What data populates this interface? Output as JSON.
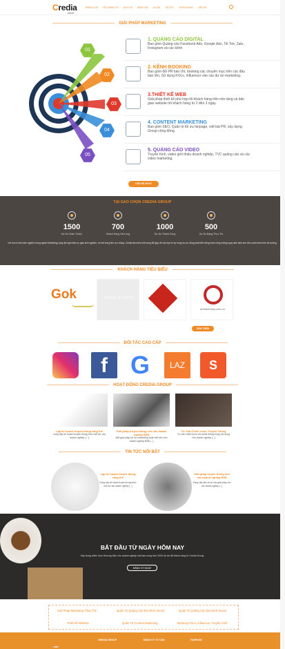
{
  "nav": {
    "logo_c": "C",
    "logo_rest": "redia",
    "logo_sub": "GROUP",
    "items": [
      "TRANG CHỦ",
      "VỀ CHÚNG TÔI",
      "DỊCH VỤ",
      "BẢNG GIÁ",
      "DỰ ÁN",
      "TIN TỨC",
      "TUYỂN DỤNG",
      "LIÊN HỆ"
    ]
  },
  "marketing": {
    "title": "GIẢI PHÁP MARKETING",
    "numbers": [
      "01",
      "02",
      "03",
      "04",
      "05"
    ],
    "items": [
      {
        "title": "1. QUẢNG CÁO DIGITAL",
        "text": "Bao gồm Quảng cáo Facebook Ads, Google Ads, Tik Tok, Zalo, Instagram và các kênh",
        "color": "#8cc63f"
      },
      {
        "title": "2. KÊNH BOOKING",
        "text": "Bao gồm đối PR báo chí, booking các chuyên mục trên các đầu báo lớn, Sử dụng KOLs, Influencer vào các dự án marketing.",
        "color": "#f08a24"
      },
      {
        "title": "3.THIẾT KẾ WEB",
        "text": "Giải pháp thiết kế phù hợp tối khách hàng trên nền tảng và bản giao website tới khách hàng từ 2 đến 3 ngày.",
        "color": "#e0392b"
      },
      {
        "title": "4. CONTENT MARKETING",
        "text": "Bao gồm SEO, Quản trị tối ưu fanpage, viết bài PR, xây dựng Group cộng đồng.",
        "color": "#3a8fd8"
      },
      {
        "title": "5. QUẢNG CÁO VIDEO",
        "text": "Truyền hình, video giới thiệu doanh nghiệp, TVC quảng cáo và các video marketing.",
        "color": "#7b4fc4"
      }
    ],
    "button": "LIÊN HỆ NGAY"
  },
  "why": {
    "title": "TẠI SAO CHỌN CREDIA GROUP",
    "stats": [
      {
        "value": "1500",
        "label": "Dự Án Hoàn Thành"
      },
      {
        "value": "700",
        "label": "Khách Hàng Hài Lòng"
      },
      {
        "value": "1000",
        "label": "Dự Án Thành Công"
      },
      {
        "value": "500",
        "label": "Dự Án Đang Thực Thi"
      }
    ],
    "desc": "Với hơn 8 năm kinh nghiệm trong ngành Marketing cùng đội ngũ nhân sự giàu kinh nghiệm, hồ hởi trong lĩnh vực thông. Credia tận hiếm mỗi dựng để giúp đỡ các bạn từ 4p trong dự án, đồng phát triển đồng hành cũng những nguy dịch lành anh đơn cạnh tranh trên thị trường."
  },
  "clients": {
    "title": "KHÁCH HÀNG TIÊU BIỂU",
    "logos": [
      "Gok",
      "SHINE STUDIO",
      "",
      "anhdoanhuy.com.vn"
    ],
    "button": "XEM THÊM"
  },
  "partners": {
    "title": "ĐỐI TÁC CAO CẤP",
    "logos": [
      "instagram-icon",
      "facebook-icon",
      "google-icon",
      "lazada-icon",
      "shopee-icon"
    ]
  },
  "activities": {
    "title": "HOẠT ĐỘNG CREDIA GROUP",
    "items": [
      {
        "title": "Lập kế hoạch truyền thông tổng thể",
        "text": "Lang dấy kế hoạch truyền thông theo mỗi dự vào doanh nghiệp, [...]"
      },
      {
        "title": "Giải pháp truyền thông cho các doanh nghiệp B2B",
        "text": "Một giải pháp tối ưu marketing hoàn kết nên cho doanh nghiệp B2B [...]"
      },
      {
        "title": "Tư Vấn Chiến Lược Truyền Thông",
        "text": "Tư vấn chiến lược cho phát thông trong nội dung cho doanh nghiệp [...]"
      }
    ]
  },
  "news": {
    "title": "TIN TỨC NỔI BẬT",
    "items": [
      {
        "title": "Lập kế hoạch truyền thông tổng thể",
        "text": "Dung xây kế hoạch truyền thông theo mỗi dự vào doanh nghiệp [...]"
      },
      {
        "title": "Giải pháp truyền thông cho các doanh nghiệp B2B",
        "text": "Dung xây trên cả dự vào giải pháp cho các doanh nghiệp [...]"
      }
    ]
  },
  "cta": {
    "title": "BẮT ĐẦU TỪ NGÀY HÔM NAY",
    "text": "Xây dựng chiến lược thương hiệu cho doanh nghiệp của bạn cùng hơn 2000 dự án đã thành công từ Credia Group.",
    "button": "ĐĂNG KÝ NGAY"
  },
  "links": [
    "Giải Pháp Marketing Tổng Thể",
    "Quản Trị Quảng Cáo Đa Kênh Social",
    "Quản Trị Quảng Cáo Đa Kênh Social",
    "Thiết Kế Website",
    "Quản Trị Content Marketing",
    "Booking KOLs, Influencer, Truyền Hình"
  ],
  "footer": {
    "logo_c": "C",
    "logo_rest": "redia",
    "cols": [
      "CREDIA GROUP",
      "ĐĂNG KÝ TƯ VẤN",
      "FANPAGE"
    ]
  }
}
